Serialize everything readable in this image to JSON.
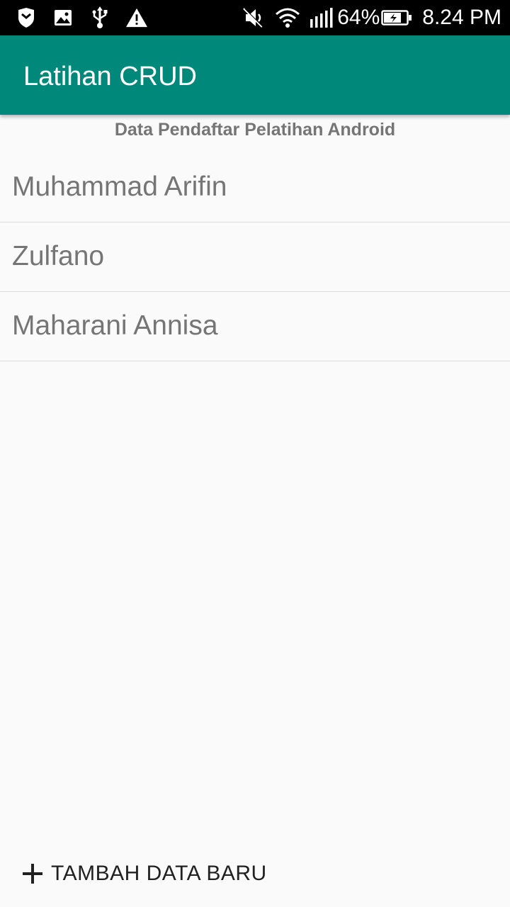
{
  "status_bar": {
    "left_icons": [
      "shield-icon",
      "image-icon",
      "usb-icon",
      "warning-icon"
    ],
    "right_icons": [
      "vibrate-off-icon",
      "wifi-icon",
      "signal-icon"
    ],
    "battery_percent": "64%",
    "battery_icon": "battery-charging-icon",
    "time": "8.24 PM"
  },
  "app_bar": {
    "title": "Latihan CRUD",
    "color": "#00897b"
  },
  "list": {
    "header": "Data Pendaftar Pelatihan Android",
    "items": [
      {
        "name": "Muhammad Arifin"
      },
      {
        "name": "Zulfano"
      },
      {
        "name": "Maharani Annisa"
      }
    ]
  },
  "footer": {
    "add_button_icon": "plus-icon",
    "add_button_label": "TAMBAH DATA BARU"
  }
}
